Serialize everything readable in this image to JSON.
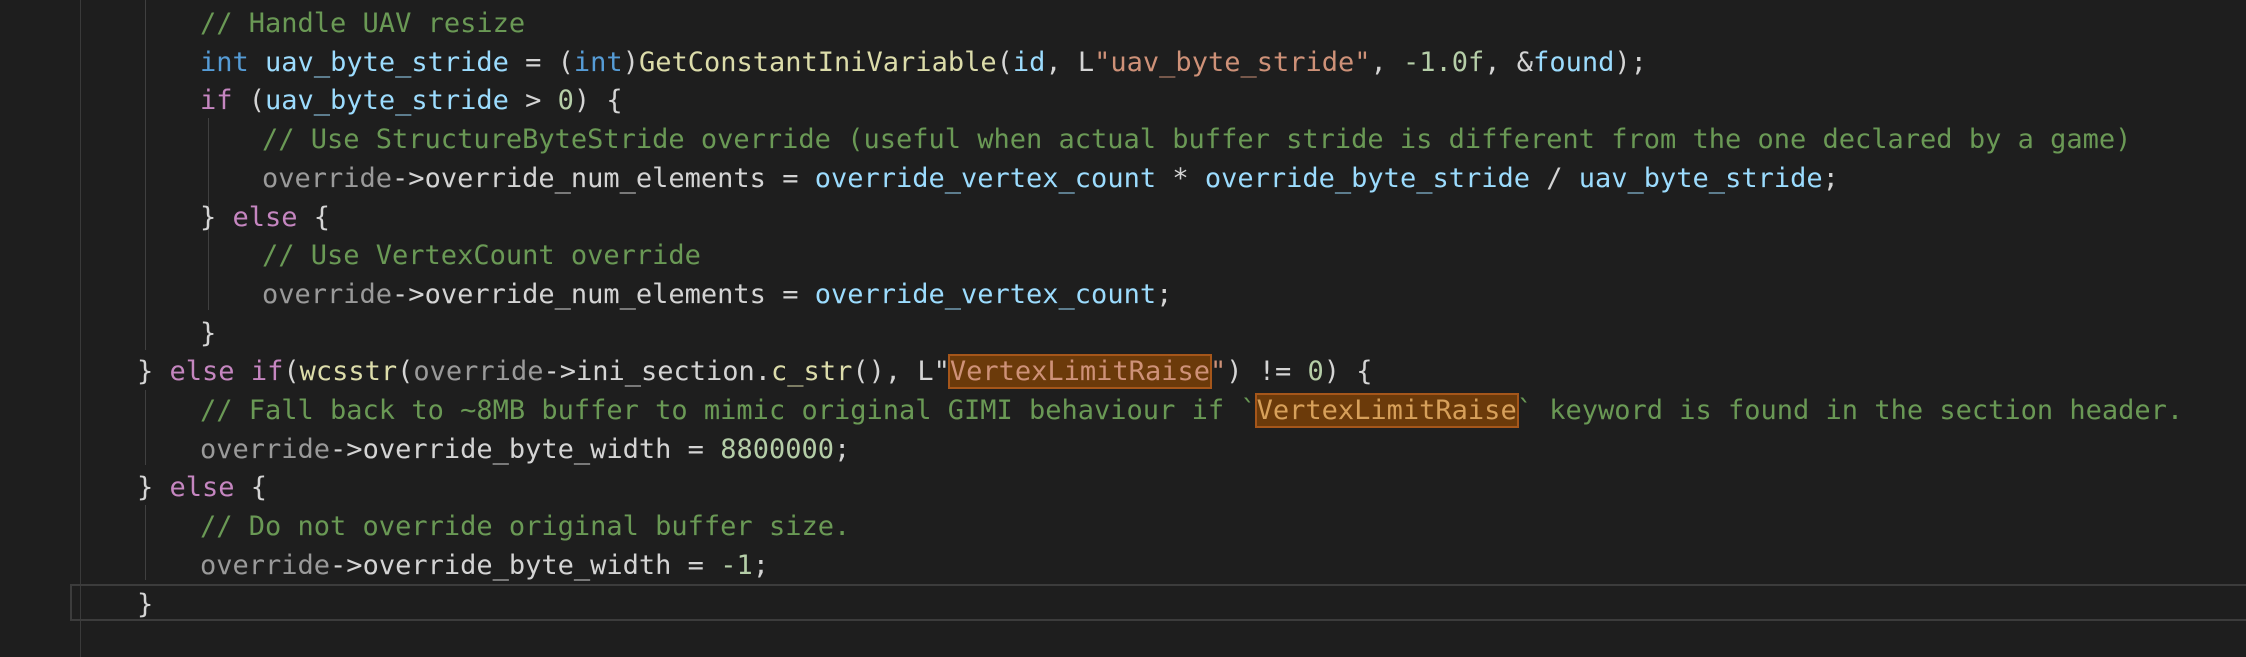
{
  "editor": {
    "lines": [
      {
        "indent": 200,
        "tokens": [
          {
            "t": "// Handle UAV resize",
            "c": "cmt"
          }
        ]
      },
      {
        "indent": 200,
        "tokens": [
          {
            "t": "int",
            "c": "kw"
          },
          {
            "t": " ",
            "c": "plain"
          },
          {
            "t": "uav_byte_stride",
            "c": "var"
          },
          {
            "t": " = (",
            "c": "plain"
          },
          {
            "t": "int",
            "c": "kw"
          },
          {
            "t": ")",
            "c": "plain"
          },
          {
            "t": "GetConstantIniVariable",
            "c": "fn"
          },
          {
            "t": "(",
            "c": "plain"
          },
          {
            "t": "id",
            "c": "var"
          },
          {
            "t": ", L",
            "c": "plain"
          },
          {
            "t": "\"uav_byte_stride\"",
            "c": "str"
          },
          {
            "t": ", ",
            "c": "plain"
          },
          {
            "t": "-1.0f",
            "c": "num"
          },
          {
            "t": ", &",
            "c": "plain"
          },
          {
            "t": "found",
            "c": "var"
          },
          {
            "t": ");",
            "c": "plain"
          }
        ]
      },
      {
        "indent": 200,
        "tokens": [
          {
            "t": "if",
            "c": "ctl"
          },
          {
            "t": " (",
            "c": "plain"
          },
          {
            "t": "uav_byte_stride",
            "c": "var"
          },
          {
            "t": " > ",
            "c": "plain"
          },
          {
            "t": "0",
            "c": "num"
          },
          {
            "t": ") {",
            "c": "plain"
          }
        ]
      },
      {
        "indent": 262,
        "tokens": [
          {
            "t": "// Use StructureByteStride override (useful when actual buffer stride is different from the one declared by a game)",
            "c": "cmt"
          }
        ]
      },
      {
        "indent": 262,
        "tokens": [
          {
            "t": "override",
            "c": "dim"
          },
          {
            "t": "->",
            "c": "plain"
          },
          {
            "t": "override_num_elements",
            "c": "plain"
          },
          {
            "t": " = ",
            "c": "plain"
          },
          {
            "t": "override_vertex_count",
            "c": "var"
          },
          {
            "t": " * ",
            "c": "plain"
          },
          {
            "t": "override_byte_stride",
            "c": "var"
          },
          {
            "t": " / ",
            "c": "plain"
          },
          {
            "t": "uav_byte_stride",
            "c": "var"
          },
          {
            "t": ";",
            "c": "plain"
          }
        ]
      },
      {
        "indent": 200,
        "tokens": [
          {
            "t": "} ",
            "c": "plain"
          },
          {
            "t": "else",
            "c": "ctl"
          },
          {
            "t": " {",
            "c": "plain"
          }
        ]
      },
      {
        "indent": 262,
        "tokens": [
          {
            "t": "// Use VertexCount override",
            "c": "cmt"
          }
        ]
      },
      {
        "indent": 262,
        "tokens": [
          {
            "t": "override",
            "c": "dim"
          },
          {
            "t": "->",
            "c": "plain"
          },
          {
            "t": "override_num_elements",
            "c": "plain"
          },
          {
            "t": " = ",
            "c": "plain"
          },
          {
            "t": "override_vertex_count",
            "c": "var"
          },
          {
            "t": ";",
            "c": "plain"
          }
        ]
      },
      {
        "indent": 200,
        "tokens": [
          {
            "t": "}",
            "c": "plain"
          }
        ]
      },
      {
        "indent": 137,
        "tokens": [
          {
            "t": "} ",
            "c": "plain"
          },
          {
            "t": "else",
            "c": "ctl"
          },
          {
            "t": " ",
            "c": "plain"
          },
          {
            "t": "if",
            "c": "ctl"
          },
          {
            "t": "(",
            "c": "plain"
          },
          {
            "t": "wcsstr",
            "c": "fn"
          },
          {
            "t": "(",
            "c": "plain"
          },
          {
            "t": "override",
            "c": "dim"
          },
          {
            "t": "->",
            "c": "plain"
          },
          {
            "t": "ini_section",
            "c": "plain"
          },
          {
            "t": ".",
            "c": "plain"
          },
          {
            "t": "c_str",
            "c": "fn"
          },
          {
            "t": "(), L\"",
            "c": "plain"
          },
          {
            "t": "VertexLimitRaise",
            "c": "hl"
          },
          {
            "t": "\"",
            "c": "str"
          },
          {
            "t": ") != ",
            "c": "plain"
          },
          {
            "t": "0",
            "c": "num"
          },
          {
            "t": ") {",
            "c": "plain"
          }
        ]
      },
      {
        "indent": 200,
        "tokens": [
          {
            "t": "// Fall back to ~8MB buffer to mimic original GIMI behaviour if `",
            "c": "cmt"
          },
          {
            "t": "VertexLimitRaise",
            "c": "hl incmt"
          },
          {
            "t": "` keyword is found in the section header.",
            "c": "cmt"
          }
        ]
      },
      {
        "indent": 200,
        "tokens": [
          {
            "t": "override",
            "c": "dim"
          },
          {
            "t": "->",
            "c": "plain"
          },
          {
            "t": "override_byte_width",
            "c": "plain"
          },
          {
            "t": " = ",
            "c": "plain"
          },
          {
            "t": "8800000",
            "c": "num"
          },
          {
            "t": ";",
            "c": "plain"
          }
        ]
      },
      {
        "indent": 137,
        "tokens": [
          {
            "t": "} ",
            "c": "plain"
          },
          {
            "t": "else",
            "c": "ctl"
          },
          {
            "t": " {",
            "c": "plain"
          }
        ]
      },
      {
        "indent": 200,
        "tokens": [
          {
            "t": "// Do not override original buffer size.",
            "c": "cmt"
          }
        ]
      },
      {
        "indent": 200,
        "tokens": [
          {
            "t": "override",
            "c": "dim"
          },
          {
            "t": "->",
            "c": "plain"
          },
          {
            "t": "override_byte_width",
            "c": "plain"
          },
          {
            "t": " = ",
            "c": "plain"
          },
          {
            "t": "-1",
            "c": "num"
          },
          {
            "t": ";",
            "c": "plain"
          }
        ]
      },
      {
        "indent": 137,
        "tokens": [
          {
            "t": "}",
            "c": "plain"
          }
        ]
      }
    ]
  }
}
